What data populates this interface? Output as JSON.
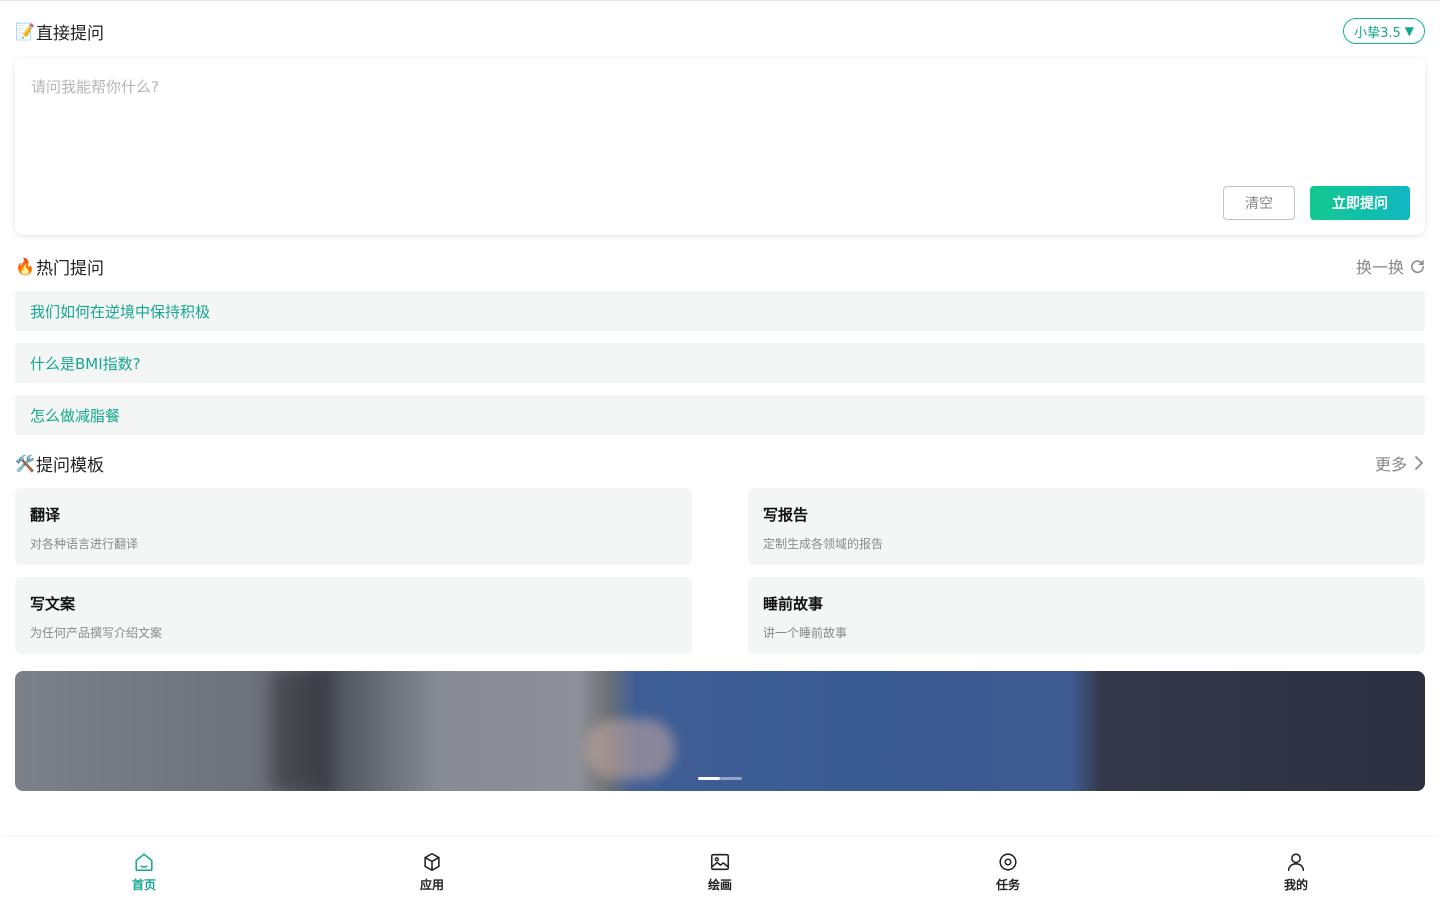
{
  "header": {
    "emoji": "📝",
    "title": "直接提问",
    "model_label": "小挚3.5",
    "model_caret": "▼"
  },
  "ask": {
    "placeholder": "请问我能帮你什么?",
    "value": "",
    "clear_label": "清空",
    "submit_label": "立即提问"
  },
  "hot": {
    "emoji": "🔥",
    "title": "热门提问",
    "refresh_label": "换一换",
    "items": [
      "我们如何在逆境中保持积极",
      "什么是BMI指数?",
      "怎么做减脂餐"
    ]
  },
  "templates": {
    "emoji": "🛠️",
    "title": "提问模板",
    "more_label": "更多",
    "cards": [
      {
        "title": "翻译",
        "desc": "对各种语言进行翻译"
      },
      {
        "title": "写报告",
        "desc": "定制生成各领域的报告"
      },
      {
        "title": "写文案",
        "desc": "为任何产品撰写介绍文案"
      },
      {
        "title": "睡前故事",
        "desc": "讲一个睡前故事"
      }
    ]
  },
  "banner": {
    "slide_count": 2,
    "active_slide": 1
  },
  "tabbar": {
    "active": "home",
    "items": [
      {
        "key": "home",
        "label": "首页",
        "icon": "home-icon"
      },
      {
        "key": "apps",
        "label": "应用",
        "icon": "cube-icon"
      },
      {
        "key": "draw",
        "label": "绘画",
        "icon": "image-icon"
      },
      {
        "key": "tasks",
        "label": "任务",
        "icon": "target-icon"
      },
      {
        "key": "mine",
        "label": "我的",
        "icon": "user-icon"
      }
    ]
  },
  "colors": {
    "accent": "#14a88f",
    "button_gradient_start": "#13c98e",
    "button_gradient_end": "#12b7c2",
    "card_bg": "#f4f6f5"
  }
}
